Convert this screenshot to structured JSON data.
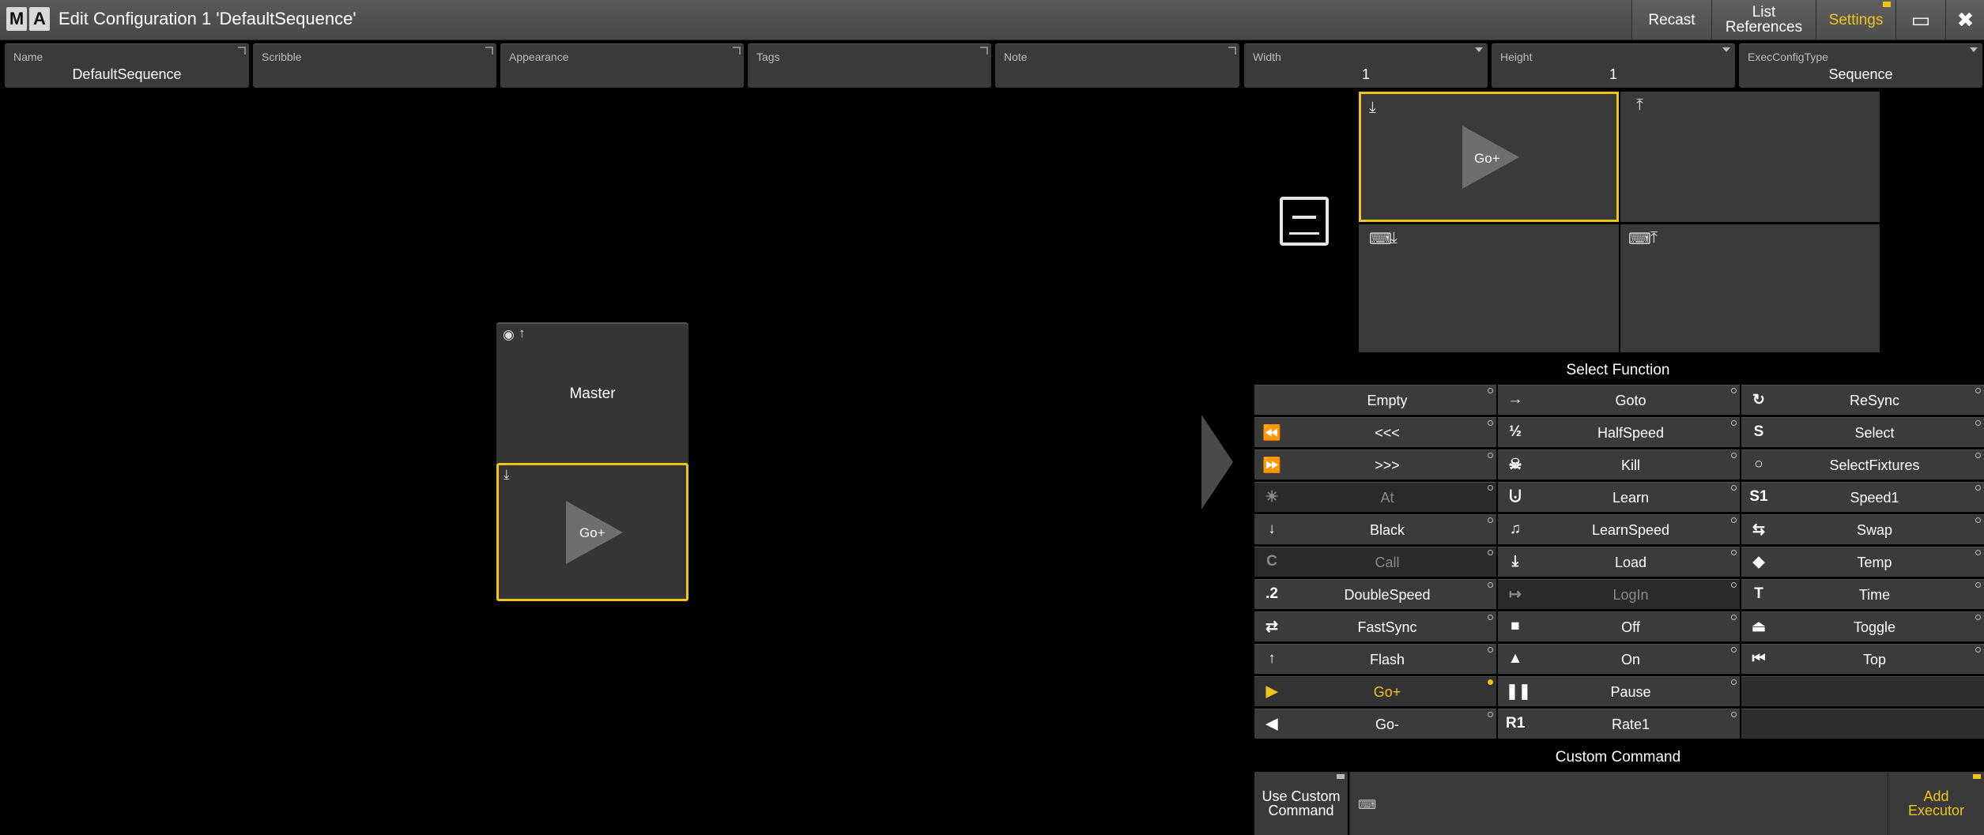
{
  "window": {
    "logo": [
      "M",
      "A"
    ],
    "title": "Edit Configuration 1 'DefaultSequence'",
    "buttons": {
      "recast": "Recast",
      "list_references": "List\nReferences",
      "settings": "Settings",
      "close": "✖",
      "display": "▭"
    }
  },
  "properties": [
    {
      "label": "Name",
      "value": "DefaultSequence"
    },
    {
      "label": "Scribble",
      "value": ""
    },
    {
      "label": "Appearance",
      "value": ""
    },
    {
      "label": "Tags",
      "value": ""
    },
    {
      "label": "Note",
      "value": ""
    },
    {
      "label": "Width",
      "value": "1"
    },
    {
      "label": "Height",
      "value": "1"
    },
    {
      "label": "ExecConfigType",
      "value": "Sequence"
    }
  ],
  "preview": {
    "master_label": "Master",
    "go_label": "Go+"
  },
  "keys": {
    "go_label": "Go+"
  },
  "select_function": {
    "title": "Select Function",
    "columns": [
      [
        {
          "icon": "",
          "label": "Empty",
          "state": "normal"
        },
        {
          "icon": "⏪",
          "label": "<<<",
          "state": "normal"
        },
        {
          "icon": "⏩",
          "label": ">>>",
          "state": "normal"
        },
        {
          "icon": "☀",
          "label": "At",
          "state": "disabled"
        },
        {
          "icon": "↓",
          "label": "Black",
          "state": "normal"
        },
        {
          "icon": "C",
          "label": "Call",
          "state": "disabled"
        },
        {
          "icon": ".2",
          "label": "DoubleSpeed",
          "state": "normal"
        },
        {
          "icon": "⇄",
          "label": "FastSync",
          "state": "normal"
        },
        {
          "icon": "↑",
          "label": "Flash",
          "state": "normal"
        },
        {
          "icon": "▶",
          "label": "Go+",
          "state": "active"
        },
        {
          "icon": "◀",
          "label": "Go-",
          "state": "normal"
        }
      ],
      [
        {
          "icon": "→",
          "label": "Goto",
          "state": "normal"
        },
        {
          "icon": "½",
          "label": "HalfSpeed",
          "state": "normal"
        },
        {
          "icon": "☠",
          "label": "Kill",
          "state": "normal"
        },
        {
          "icon": "⨃",
          "label": "Learn",
          "state": "normal"
        },
        {
          "icon": "♫",
          "label": "LearnSpeed",
          "state": "normal"
        },
        {
          "icon": "⤓",
          "label": "Load",
          "state": "normal"
        },
        {
          "icon": "↦",
          "label": "LogIn",
          "state": "disabled"
        },
        {
          "icon": "■",
          "label": "Off",
          "state": "normal"
        },
        {
          "icon": "▲",
          "label": "On",
          "state": "normal"
        },
        {
          "icon": "❚❚",
          "label": "Pause",
          "state": "normal"
        },
        {
          "icon": "R1",
          "label": "Rate1",
          "state": "normal"
        }
      ],
      [
        {
          "icon": "↻",
          "label": "ReSync",
          "state": "normal"
        },
        {
          "icon": "S",
          "label": "Select",
          "state": "normal"
        },
        {
          "icon": "○",
          "label": "SelectFixtures",
          "state": "normal"
        },
        {
          "icon": "S1",
          "label": "Speed1",
          "state": "normal"
        },
        {
          "icon": "⇆",
          "label": "Swap",
          "state": "normal"
        },
        {
          "icon": "◆",
          "label": "Temp",
          "state": "normal"
        },
        {
          "icon": "T",
          "label": "Time",
          "state": "normal"
        },
        {
          "icon": "⏏",
          "label": "Toggle",
          "state": "normal"
        },
        {
          "icon": "⏮",
          "label": "Top",
          "state": "normal"
        },
        {
          "icon": "",
          "label": "",
          "state": "blank"
        },
        {
          "icon": "",
          "label": "",
          "state": "blank"
        }
      ]
    ]
  },
  "custom_command": {
    "title": "Custom Command",
    "use_label": "Use Custom\nCommand",
    "add_label": "Add\nExecutor",
    "input_value": ""
  }
}
